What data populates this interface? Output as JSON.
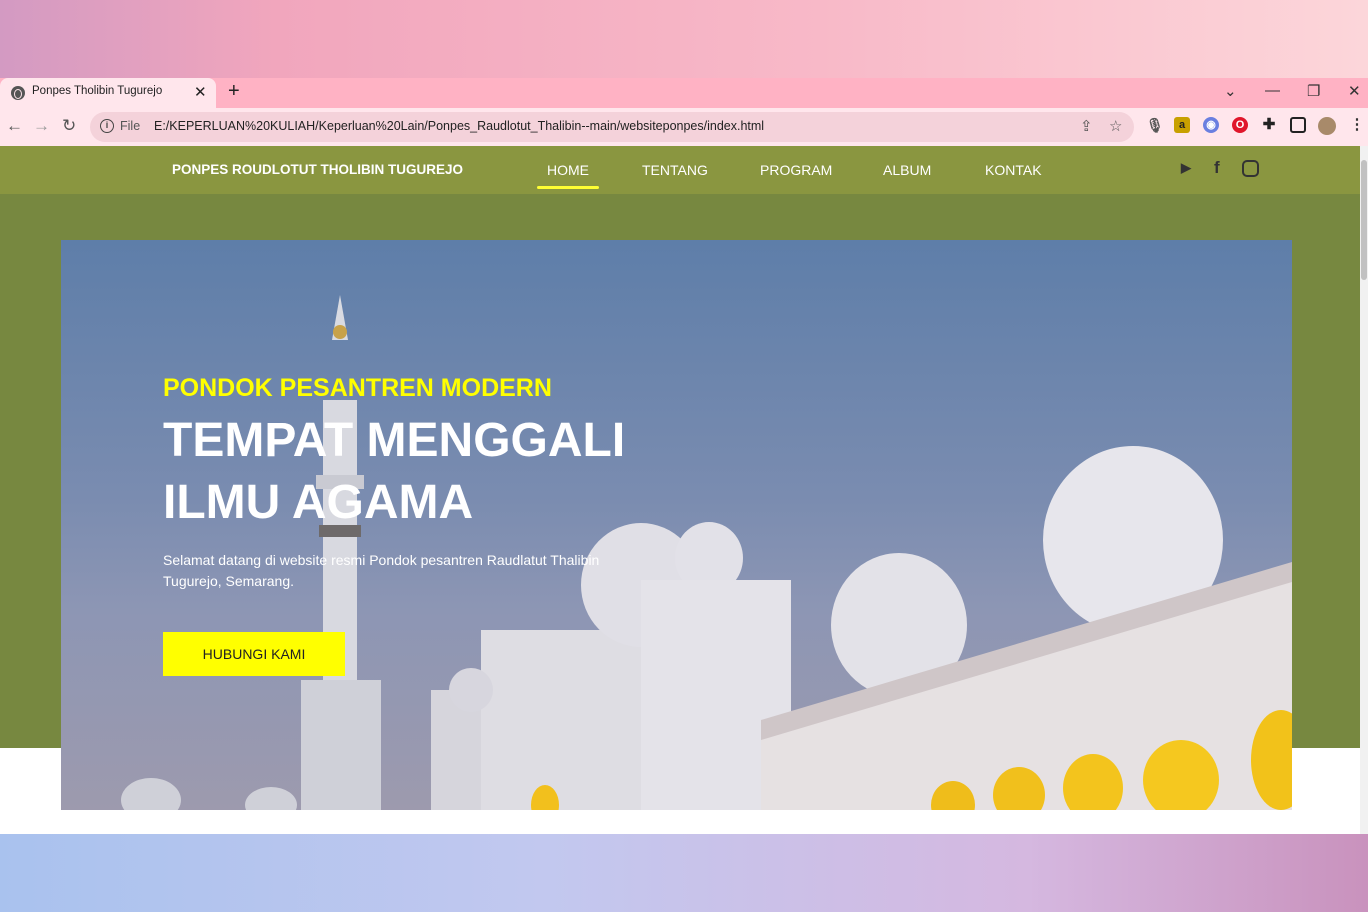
{
  "browser": {
    "tab_title": "Ponpes Tholibin Tugurejo",
    "file_label": "File",
    "url": "E:/KEPERLUAN%20KULIAH/Keperluan%20Lain/Ponpes_Raudlotut_Thalibin--main/websiteponpes/index.html"
  },
  "site": {
    "brand": "PONPES ROUDLOTUT THOLIBIN TUGUREJO",
    "menu": [
      "HOME",
      "TENTANG",
      "PROGRAM",
      "ALBUM",
      "KONTAK"
    ],
    "active_menu": "HOME",
    "social_icons": [
      "youtube-icon",
      "facebook-icon",
      "instagram-icon"
    ]
  },
  "hero": {
    "kicker": "PONDOK PESANTREN MODERN",
    "headline": "TEMPAT MENGGALI ILMU AGAMA",
    "description": "Selamat datang di website resmi Pondok pesantren Raudlatut Thalibin Tugurejo, Semarang.",
    "cta_label": "HUBUNGI KAMI"
  },
  "colors": {
    "navbar": "#8a9640",
    "band": "#778840",
    "accent": "#ffff00",
    "tabbar": "#ffb2c4"
  }
}
